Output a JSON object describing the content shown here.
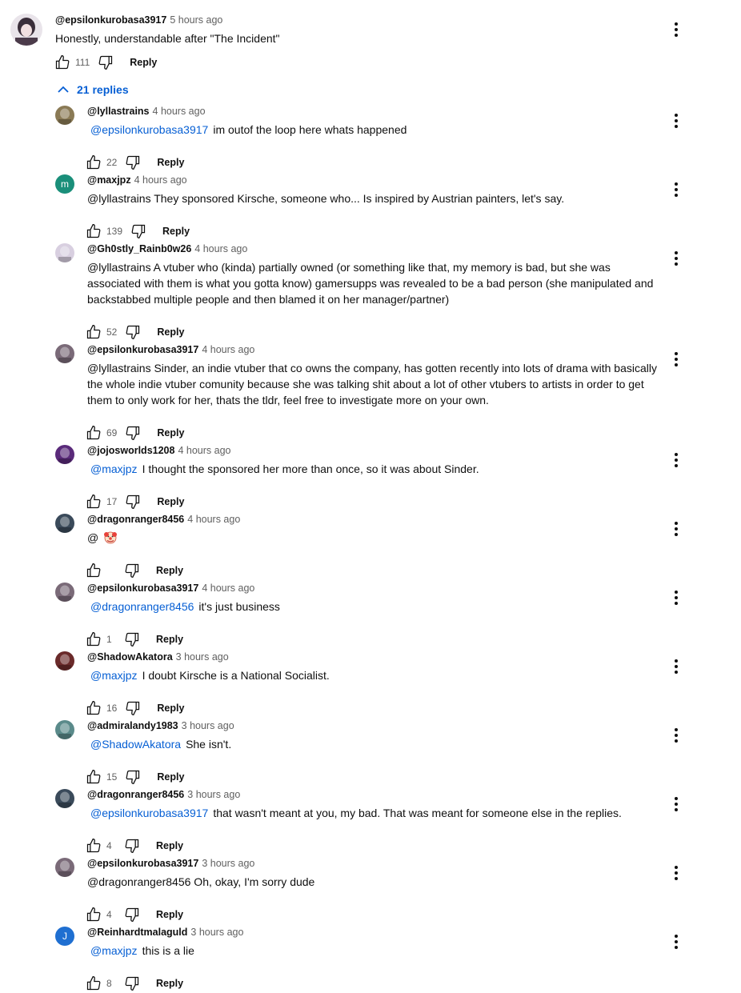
{
  "top_comment": {
    "author": "@epsilonkurobasa3917",
    "time": "5 hours ago",
    "text": "Honestly, understandable after \"The Incident\"",
    "likes": "111",
    "reply_label": "Reply",
    "avatar_color": "#7a6a78"
  },
  "replies_toggle": {
    "label": "21 replies"
  },
  "replies": [
    {
      "author": "@lyllastrains",
      "time": "4 hours ago",
      "mention": "@epsilonkurobasa3917",
      "text": "im outof the loop here whats happened",
      "likes": "22",
      "reply_label": "Reply",
      "avatar_color": "#8a7a55",
      "avatar_letter": ""
    },
    {
      "author": "@maxjpz",
      "time": "4 hours ago",
      "mention": "",
      "text": "@lyllastrains  They sponsored Kirsche, someone who... Is inspired by Austrian painters, let's say.",
      "likes": "139",
      "reply_label": "Reply",
      "avatar_color": "#1a8f7a",
      "avatar_letter": "m"
    },
    {
      "author": "@Gh0stly_Rainb0w26",
      "time": "4 hours ago",
      "mention": "",
      "text_lines": [
        "@lyllastrains A vtuber who (kinda) partially owned (or something like that, my memory is bad, but she was",
        "associated with them is what you gotta know) gamersupps was revealed to be a bad person (she manipulated and",
        "backstabbed multiple people and then blamed it on her manager/partner)"
      ],
      "likes": "52",
      "reply_label": "Reply",
      "avatar_color": "#d8cfe0",
      "avatar_letter": ""
    },
    {
      "author": "@epsilonkurobasa3917",
      "time": "4 hours ago",
      "mention": "",
      "text_lines": [
        "@lyllastrains  Sinder, an indie vtuber that co owns the company, has gotten recently into lots of drama with basically",
        "the whole indie vtuber comunity because she was talking shit about a lot of other vtubers to artists in order to get",
        "them to only work for her, thats the tldr, feel free to investigate more on your own."
      ],
      "likes": "69",
      "reply_label": "Reply",
      "avatar_color": "#7a6a78",
      "avatar_letter": ""
    },
    {
      "author": "@jojosworlds1208",
      "time": "4 hours ago",
      "mention": "@maxjpz",
      "text": "I thought the sponsored her more than once, so it was about Sinder.",
      "likes": "17",
      "reply_label": "Reply",
      "avatar_color": "#5a2a7a",
      "avatar_letter": ""
    },
    {
      "author": "@dragonranger8456",
      "time": "4 hours ago",
      "mention": "",
      "text": "@",
      "emoji": "clown-face",
      "likes": "",
      "reply_label": "Reply",
      "avatar_color": "#3a4a5a",
      "avatar_letter": ""
    },
    {
      "author": "@epsilonkurobasa3917",
      "time": "4 hours ago",
      "mention": "@dragonranger8456",
      "text": "it's just business",
      "likes": "1",
      "reply_label": "Reply",
      "avatar_color": "#7a6a78",
      "avatar_letter": ""
    },
    {
      "author": "@ShadowAkatora",
      "time": "3 hours ago",
      "mention": "@maxjpz",
      "text": "I doubt Kirsche is a National Socialist.",
      "likes": "16",
      "reply_label": "Reply",
      "avatar_color": "#6a2a2a",
      "avatar_letter": ""
    },
    {
      "author": "@admiralandy1983",
      "time": "3 hours ago",
      "mention": "@ShadowAkatora",
      "text": "She isn't.",
      "likes": "15",
      "reply_label": "Reply",
      "avatar_color": "#5a8a8a",
      "avatar_letter": ""
    },
    {
      "author": "@dragonranger8456",
      "time": "3 hours ago",
      "mention": "@epsilonkurobasa3917",
      "text": "that wasn't meant at you, my bad. That was meant for someone else in the replies.",
      "likes": "4",
      "reply_label": "Reply",
      "avatar_color": "#3a4a5a",
      "avatar_letter": ""
    },
    {
      "author": "@epsilonkurobasa3917",
      "time": "3 hours ago",
      "mention": "",
      "text": "@dragonranger8456  Oh, okay, I'm sorry dude",
      "likes": "4",
      "reply_label": "Reply",
      "avatar_color": "#7a6a78",
      "avatar_letter": ""
    },
    {
      "author": "@Reinhardtmalaguld",
      "time": "3 hours ago",
      "mention": "@maxjpz",
      "text": "this is a lie",
      "likes": "8",
      "reply_label": "Reply",
      "avatar_color": "#1f6fd1",
      "avatar_letter": "J"
    }
  ]
}
